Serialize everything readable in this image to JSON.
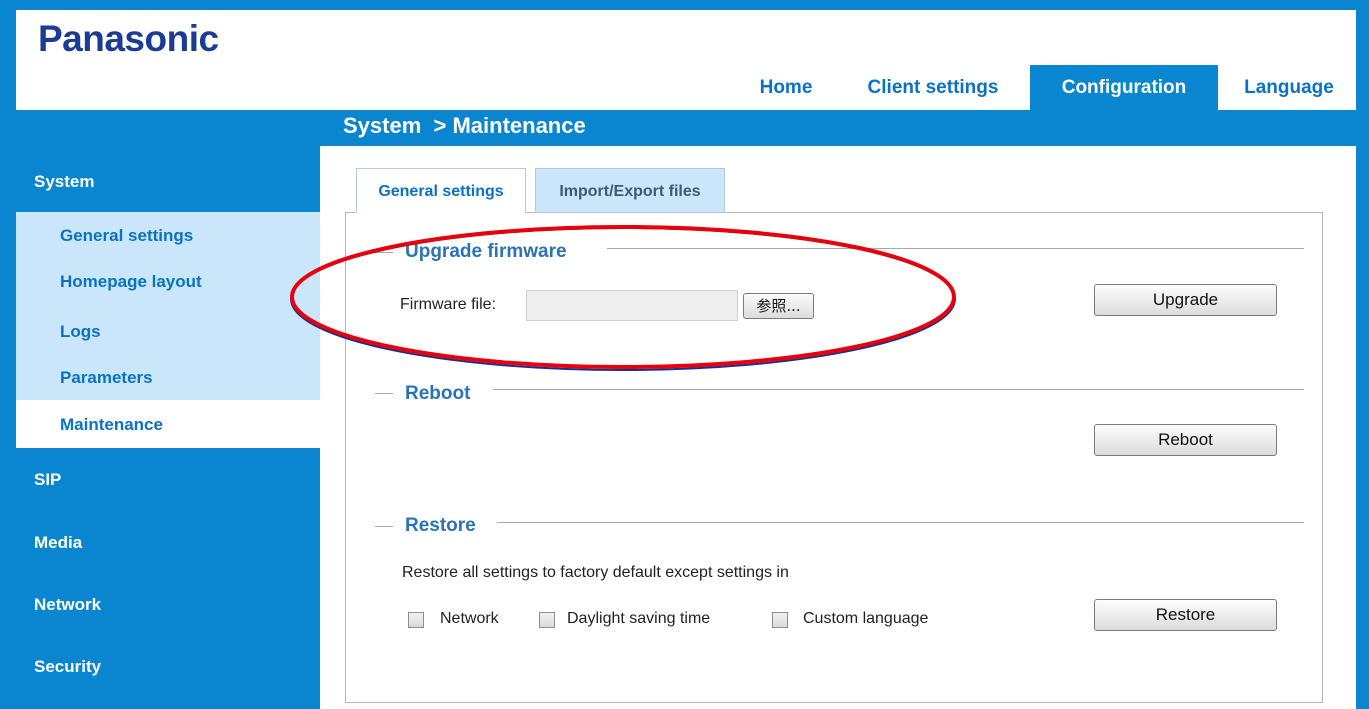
{
  "brand": {
    "logo": "Panasonic"
  },
  "nav_tabs": [
    {
      "label": "Home",
      "active": false
    },
    {
      "label": "Client settings",
      "active": false
    },
    {
      "label": "Configuration",
      "active": true
    },
    {
      "label": "Language",
      "active": false
    }
  ],
  "breadcrumb": "System  > Maintenance",
  "sidebar": {
    "system": "System",
    "sub_items": [
      "General settings",
      "Homepage layout",
      "Logs",
      "Parameters",
      "Maintenance"
    ],
    "selected": "Maintenance",
    "sections": [
      "SIP",
      "Media",
      "Network",
      "Security"
    ]
  },
  "sub_tabs": [
    {
      "label": "General settings",
      "active": true
    },
    {
      "label": "Import/Export files",
      "active": false
    }
  ],
  "upgrade": {
    "title": "Upgrade firmware",
    "file_label": "Firmware file:",
    "file_value": "",
    "browse_label": "参照...",
    "button": "Upgrade"
  },
  "reboot": {
    "title": "Reboot",
    "button": "Reboot"
  },
  "restore": {
    "title": "Restore",
    "description": "Restore all settings to factory default except settings in",
    "options": [
      {
        "label": "Network",
        "checked": false
      },
      {
        "label": "Daylight saving time",
        "checked": false
      },
      {
        "label": "Custom language",
        "checked": false
      }
    ],
    "button": "Restore"
  },
  "colors": {
    "primary_blue": "#0a86d0",
    "logo_blue": "#1a3c96",
    "link_blue": "#0a72c4",
    "light_blue": "#c9e6fa",
    "annotation_red": "#e8000b"
  }
}
